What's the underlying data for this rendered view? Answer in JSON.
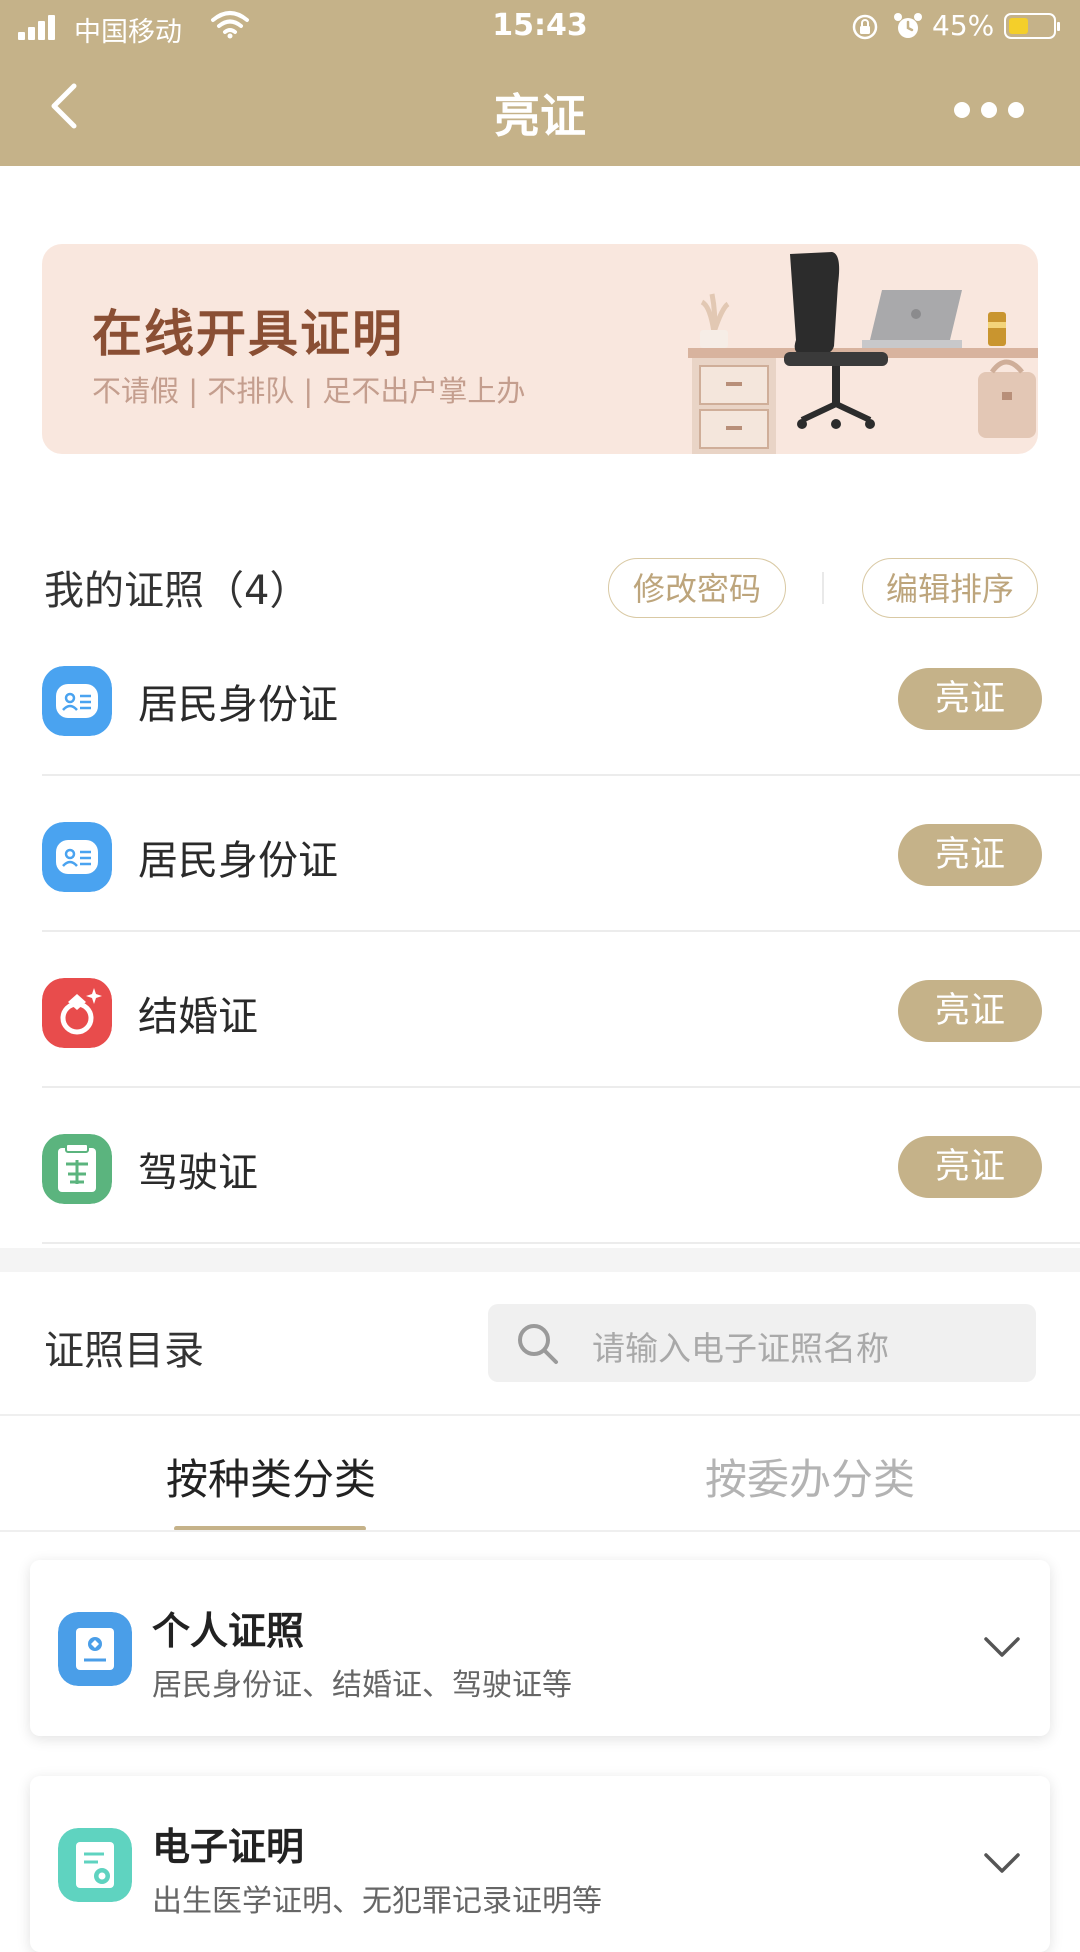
{
  "status_bar": {
    "carrier": "中国移动",
    "time": "15:43",
    "battery": "45%",
    "battery_level": 0.45,
    "icons": [
      "signal-icon",
      "wifi-icon",
      "orientation-lock-icon",
      "alarm-icon",
      "battery-icon"
    ]
  },
  "nav": {
    "title": "亮证",
    "back_icon": "chevron-left-icon",
    "more_icon": "more-dots-icon"
  },
  "banner": {
    "title": "在线开具证明",
    "subtitle": "不请假 | 不排队 | 足不出户掌上办"
  },
  "my_licenses": {
    "title": "我的证照（4）",
    "change_password": "修改密码",
    "edit_order": "编辑排序",
    "items": [
      {
        "name": "居民身份证",
        "button": "亮证",
        "icon": "id-card-icon",
        "color": "#4aa3f0"
      },
      {
        "name": "居民身份证",
        "button": "亮证",
        "icon": "id-card-icon",
        "color": "#4aa3f0"
      },
      {
        "name": "结婚证",
        "button": "亮证",
        "icon": "marriage-certificate-icon",
        "color": "#e84c4c"
      },
      {
        "name": "驾驶证",
        "button": "亮证",
        "icon": "driving-license-icon",
        "color": "#5bb47e"
      }
    ]
  },
  "catalog": {
    "title": "证照目录",
    "search_placeholder": "请输入电子证照名称",
    "tabs": [
      {
        "label": "按种类分类",
        "active": true
      },
      {
        "label": "按委办分类",
        "active": false
      }
    ],
    "categories": [
      {
        "title": "个人证照",
        "desc": "居民身份证、结婚证、驾驶证等",
        "icon": "personal-license-icon",
        "color": "#4a9ee8"
      },
      {
        "title": "电子证明",
        "desc": "出生医学证明、无犯罪记录证明等",
        "icon": "e-certificate-icon",
        "color": "#5fd3c0"
      }
    ]
  },
  "colors": {
    "accent": "#c5b289",
    "banner_bg": "#f9e7de",
    "banner_title": "#8a4f34"
  }
}
